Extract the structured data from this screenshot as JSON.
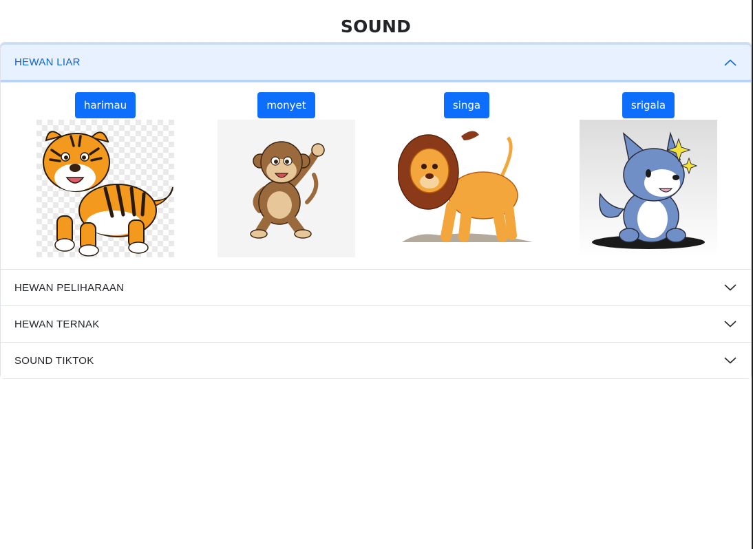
{
  "page": {
    "title": "SOUND"
  },
  "sections": [
    {
      "label": "HEWAN LIAR",
      "expanded": true
    },
    {
      "label": "HEWAN PELIHARAAN",
      "expanded": false
    },
    {
      "label": "HEWAN TERNAK",
      "expanded": false
    },
    {
      "label": "SOUND TIKTOK",
      "expanded": false
    }
  ],
  "wild_animals": [
    {
      "label": "harimau",
      "icon": "tiger-image"
    },
    {
      "label": "monyet",
      "icon": "monkey-image"
    },
    {
      "label": "singa",
      "icon": "lion-image"
    },
    {
      "label": "srigala",
      "icon": "wolf-image"
    }
  ],
  "colors": {
    "accent": "#0d6efd",
    "active_header_bg": "#e7f1ff",
    "active_header_text": "#0c63e4"
  }
}
